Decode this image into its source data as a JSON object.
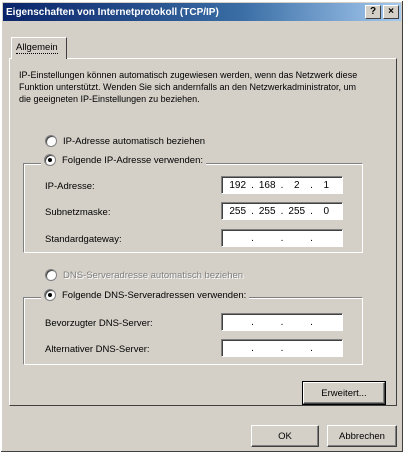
{
  "window": {
    "title": "Eigenschaften von Internetprotokoll (TCP/IP)",
    "help_glyph": "?",
    "close_glyph": "×"
  },
  "tabs": [
    {
      "label": "Allgemein"
    }
  ],
  "intro_text": "IP-Einstellungen können automatisch zugewiesen werden, wenn das Netzwerk diese Funktion unterstützt. Wenden Sie sich andernfalls an den Netzwerkadministrator, um die geeigneten IP-Einstellungen zu beziehen.",
  "ip": {
    "auto_label": "IP-Adresse automatisch beziehen",
    "auto_checked": false,
    "manual_label": "Folgende IP-Adresse verwenden:",
    "manual_checked": true,
    "fields": [
      {
        "label": "IP-Adresse:",
        "octets": [
          "192",
          "168",
          "2",
          "1"
        ]
      },
      {
        "label": "Subnetzmaske:",
        "octets": [
          "255",
          "255",
          "255",
          "0"
        ]
      },
      {
        "label": "Standardgateway:",
        "octets": [
          "",
          "",
          "",
          ""
        ]
      }
    ]
  },
  "dns": {
    "auto_label": "DNS-Serveradresse automatisch beziehen",
    "auto_checked": false,
    "manual_label": "Folgende DNS-Serveradressen verwenden:",
    "manual_checked": true,
    "fields": [
      {
        "label": "Bevorzugter DNS-Server:",
        "octets": [
          "",
          "",
          "",
          ""
        ]
      },
      {
        "label": "Alternativer DNS-Server:",
        "octets": [
          "",
          "",
          "",
          ""
        ]
      }
    ]
  },
  "buttons": {
    "advanced": "Erweitert...",
    "ok": "OK",
    "cancel": "Abbrechen"
  }
}
